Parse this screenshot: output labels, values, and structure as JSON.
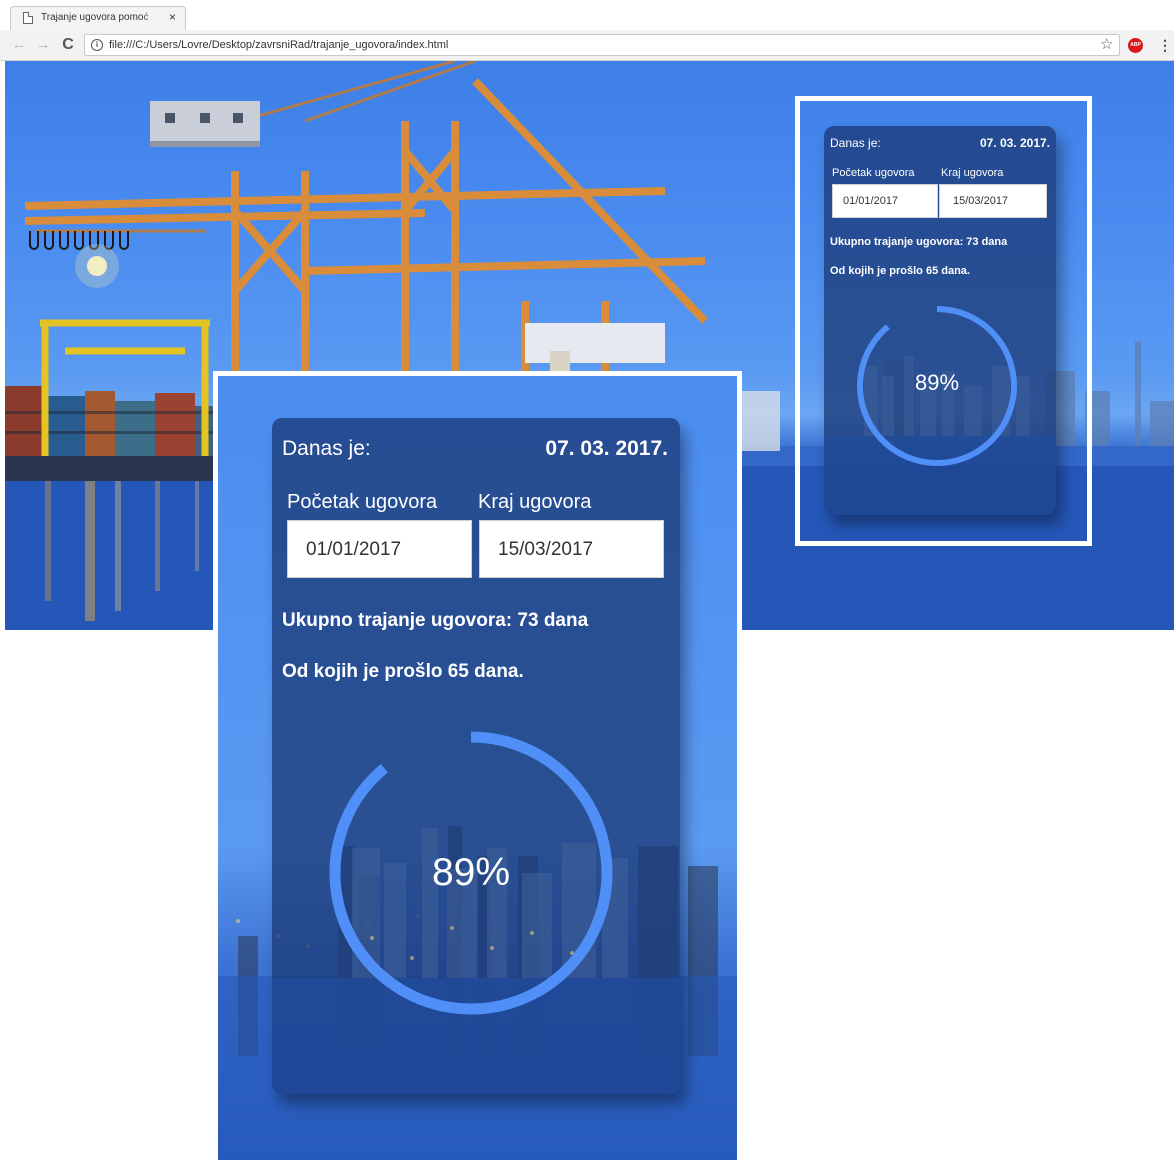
{
  "browser": {
    "tab_title": "Trajanje ugovora pomoć",
    "tab_close_glyph": "×",
    "url": "file:///C:/Users/Lovre/Desktop/zavrsniRad/trajanje_ugovora/index.html",
    "back_glyph": "←",
    "forward_glyph": "→",
    "reload_glyph": "C",
    "info_glyph": "i",
    "star_glyph": "☆",
    "abp_label": "ABP",
    "menu_glyph": "⋮"
  },
  "app": {
    "today_label": "Danas je:",
    "today_value": "07. 03. 2017.",
    "start_label": "Početak ugovora",
    "end_label": "Kraj ugovora",
    "start_value": "01/01/2017",
    "end_value": "15/03/2017",
    "total_text": "Ukupno trajanje ugovora: 73 dana",
    "elapsed_text": "Od kojih je prošlo 65 dana.",
    "percent_text": "89%",
    "progress": 0.89
  },
  "colors": {
    "ring": "#4f8ff7",
    "card": "#1c3b78"
  },
  "icons": [
    "document-icon",
    "close-icon",
    "back-arrow-icon",
    "forward-arrow-icon",
    "reload-icon",
    "info-icon",
    "star-icon",
    "adblock-icon",
    "menu-icon"
  ]
}
